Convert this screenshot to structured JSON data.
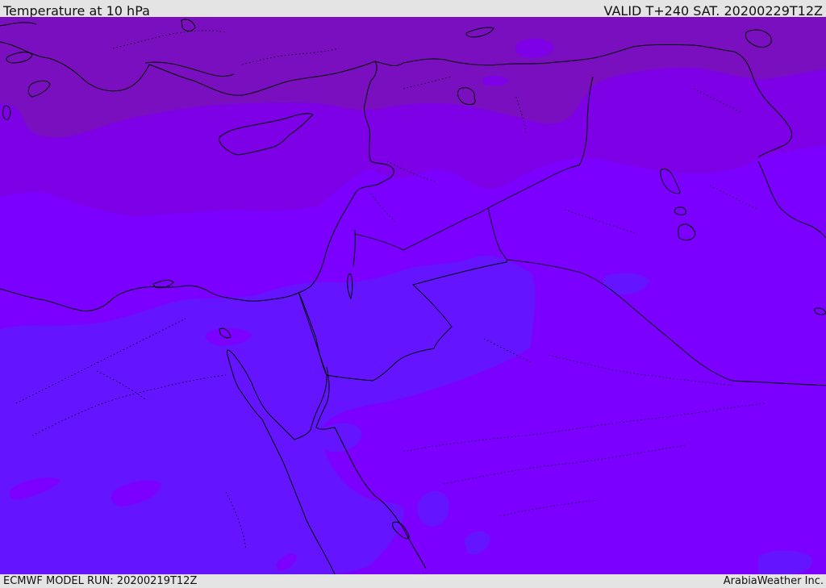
{
  "header": {
    "title": "Temperature at 10 hPa",
    "valid_time": "VALID T+240 SAT. 20200229T12Z"
  },
  "footer": {
    "model_run": "ECMWF MODEL RUN: 20200219T12Z",
    "credit": "ArabiaWeather Inc."
  },
  "map": {
    "region": "Eastern Mediterranean, Levant, Egypt and Arabian Peninsula",
    "field_colors": {
      "band_cold_north": "#7a0fbf",
      "band_mid": "#7d00e6",
      "band_main": "#7c00ff",
      "band_warm_south": "#6414ff"
    },
    "coastline_color": "#000000",
    "border_style": "dotted"
  }
}
